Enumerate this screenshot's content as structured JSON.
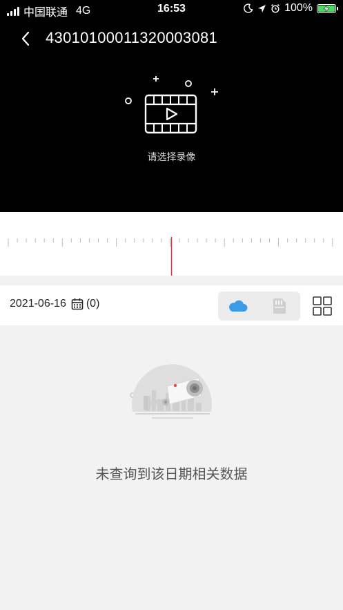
{
  "status_bar": {
    "carrier": "中国联通",
    "network": "4G",
    "time": "16:53",
    "battery_text": "100%",
    "battery_level": 1.0,
    "battery_color": "#4cd964"
  },
  "nav": {
    "back_icon": "chevron-left-icon",
    "title": "43010100011320003081"
  },
  "player": {
    "placeholder_icon": "video-film-icon",
    "hint": "请选择录像"
  },
  "timeline": {
    "cursor_color": "#c8404a"
  },
  "toolbar": {
    "date": "2021-06-16",
    "calendar_icon": "calendar-icon",
    "count": "(0)",
    "cloud_icon": "cloud-icon",
    "cloud_color": "#3a9be8",
    "sdcard_icon": "sd-card-icon",
    "grid_icon": "grid-layout-icon"
  },
  "empty": {
    "illustration": "camera-empty-illustration",
    "message": "未查询到该日期相关数据"
  }
}
